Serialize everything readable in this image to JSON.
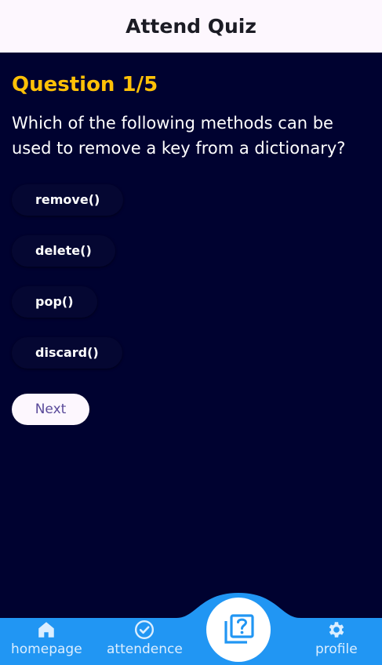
{
  "appbar": {
    "title": "Attend Quiz"
  },
  "quiz": {
    "counter": "Question 1/5",
    "question": "Which of the following methods can be used to remove a key from a dictionary?",
    "options": [
      "remove()",
      "delete()",
      "pop()",
      "discard()"
    ],
    "next_label": "Next"
  },
  "nav": {
    "items": [
      {
        "label": "homepage",
        "icon": "home-icon"
      },
      {
        "label": "attendence",
        "icon": "check-circle-icon"
      },
      {
        "label": "",
        "icon": "quiz-icon"
      },
      {
        "label": "profile",
        "icon": "gear-icon"
      }
    ]
  },
  "colors": {
    "background": "#000230",
    "appbar": "#fdf7fe",
    "accent_yellow": "#ffc107",
    "nav_blue": "#2196f3"
  }
}
